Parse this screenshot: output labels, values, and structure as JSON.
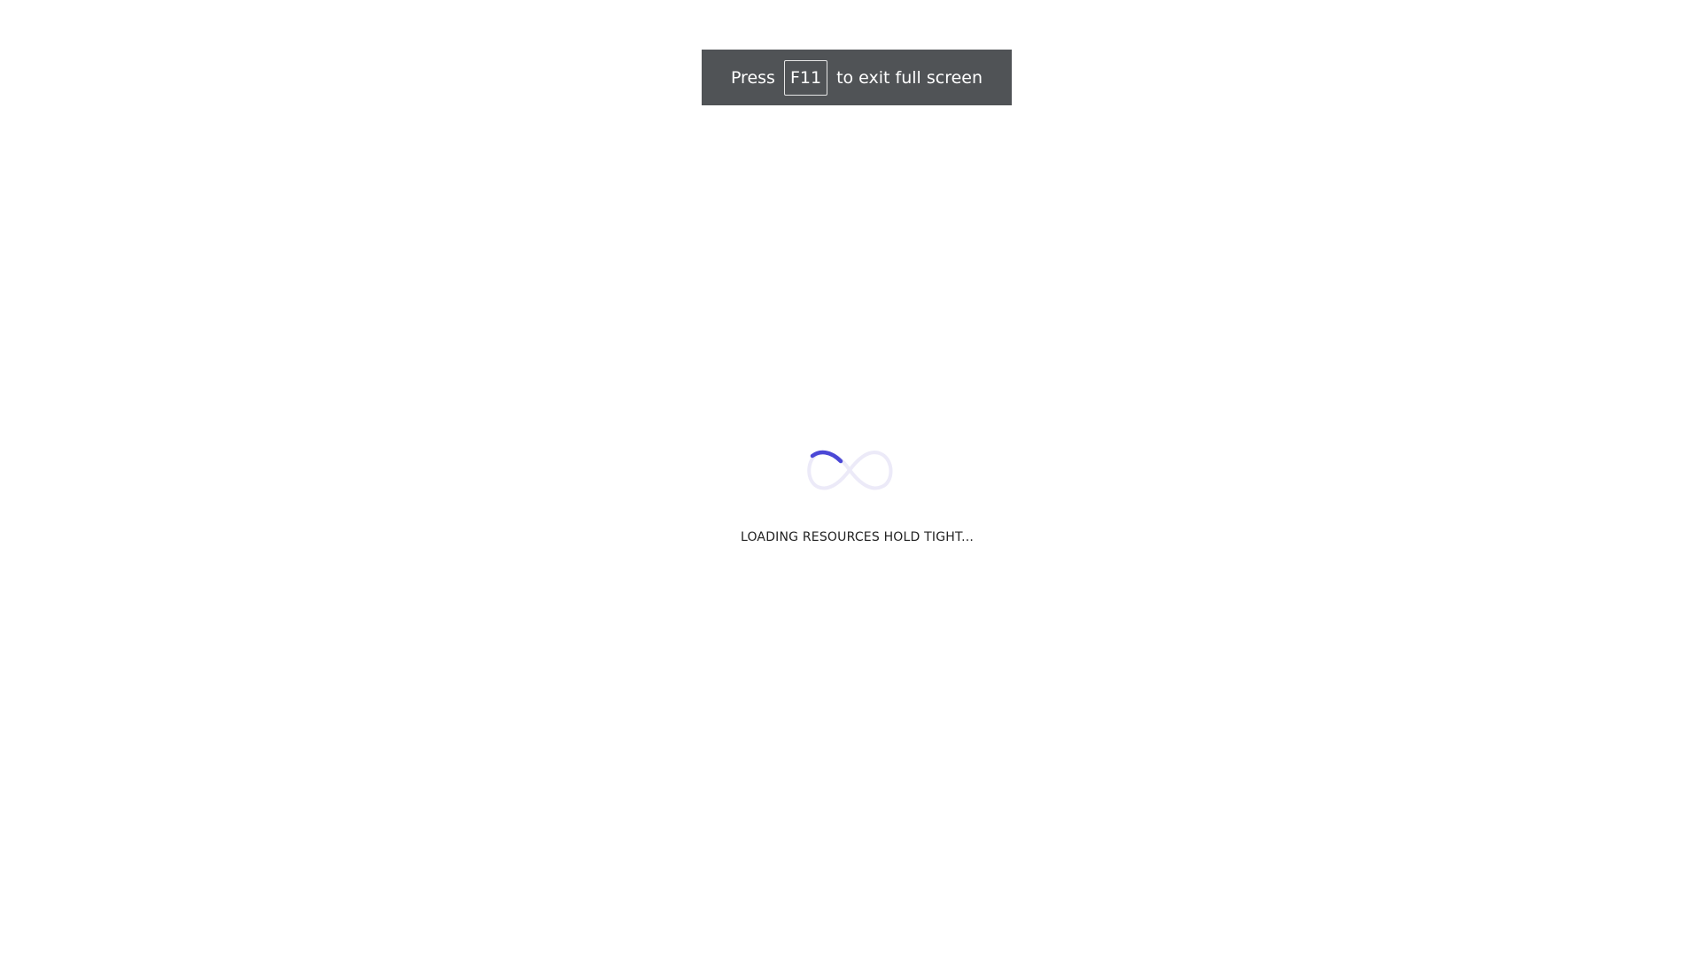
{
  "fullscreen_notice": {
    "prefix": "Press",
    "key": "F11",
    "suffix": "to exit full screen"
  },
  "loader": {
    "icon": "infinity-spinner-icon",
    "accent_color": "#4b48d6",
    "track_color": "#eceaf8"
  },
  "loading_message": "LOADING RESOURCES HOLD TIGHT..."
}
